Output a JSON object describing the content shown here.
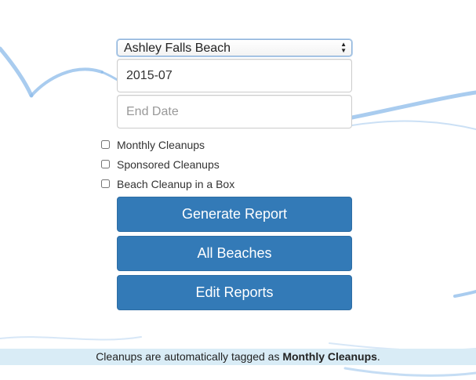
{
  "form": {
    "beach_select": {
      "selected": "Ashley Falls Beach"
    },
    "start_date": {
      "value": "2015-07"
    },
    "end_date": {
      "value": "",
      "placeholder": "End Date"
    }
  },
  "checkboxes": [
    {
      "label": "Monthly Cleanups",
      "checked": false
    },
    {
      "label": "Sponsored Cleanups",
      "checked": false
    },
    {
      "label": "Beach Cleanup in a Box",
      "checked": false
    }
  ],
  "buttons": {
    "generate_report": "Generate Report",
    "all_beaches": "All Beaches",
    "edit_reports": "Edit Reports"
  },
  "footer": {
    "text_before": "Cleanups are automatically tagged as ",
    "emphasis": "Monthly Cleanups",
    "text_after": "."
  },
  "colors": {
    "primary_button": "#337ab7",
    "footer_bg": "#d9ecf6",
    "background_swirl": "#7fb3e6"
  }
}
